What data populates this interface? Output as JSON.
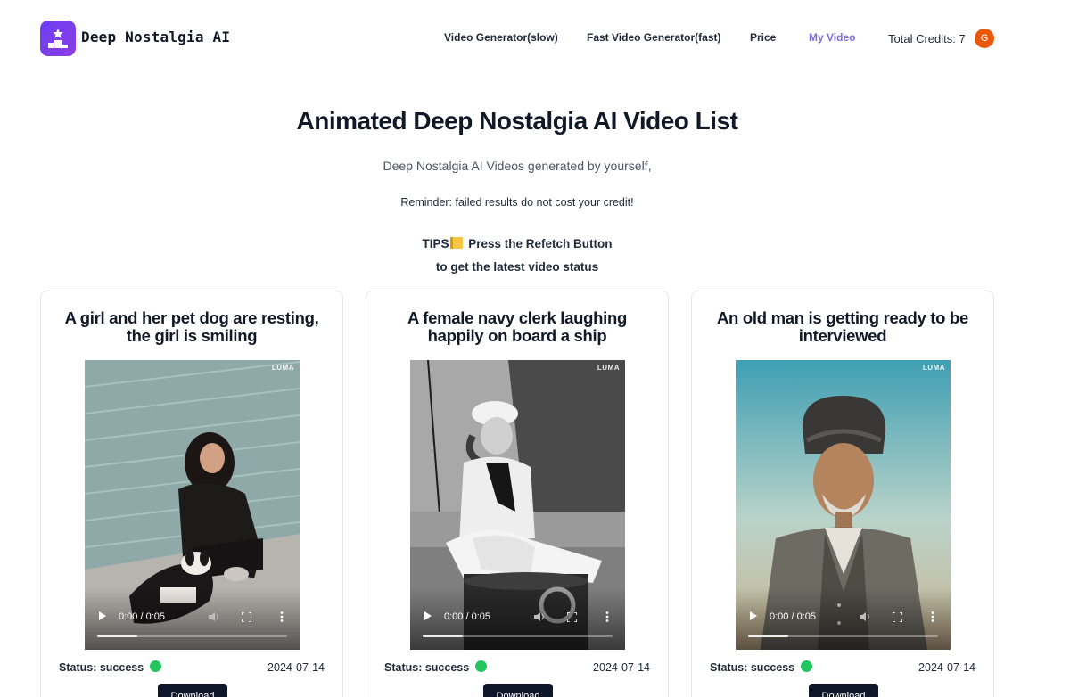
{
  "header": {
    "brand": "Deep Nostalgia AI",
    "nav": [
      {
        "label": "Video Generator(slow)",
        "active": false
      },
      {
        "label": "Fast Video Generator(fast)",
        "active": false
      },
      {
        "label": "Price",
        "active": false
      },
      {
        "label": "My Video",
        "active": true
      }
    ],
    "credits_label": "Total Credits: 7",
    "avatar_initial": "G"
  },
  "intro": {
    "title": "Animated Deep Nostalgia AI Video List",
    "subtitle": "Deep Nostalgia AI Videos generated by yourself,",
    "reminder": "Reminder: failed results do not cost your credit!",
    "tips_prefix": "TIPS",
    "tips_line1": "Press the Refetch Button",
    "tips_line2": "to get the latest video status"
  },
  "videos": [
    {
      "title": "A girl and her pet dog are resting, the girl is smiling",
      "watermark": "LUMA",
      "time": "0:00 / 0:05",
      "status": "Status: success",
      "date": "2024-07-14",
      "download_label": "Download"
    },
    {
      "title": "A female navy clerk laughing happily on board a ship",
      "watermark": "LUMA",
      "time": "0:00 / 0:05",
      "status": "Status: success",
      "date": "2024-07-14",
      "download_label": "Download"
    },
    {
      "title": "An old man is getting ready to be interviewed",
      "watermark": "LUMA",
      "time": "0:00 / 0:05",
      "status": "Status: success",
      "date": "2024-07-14",
      "download_label": "Download"
    }
  ],
  "colors": {
    "accent": "#7c6fe0",
    "logo": "#6d3df5",
    "status_success": "#22c55e",
    "button": "#0f172a",
    "avatar": "#ea580c"
  },
  "icons": [
    "podium-star-icon",
    "play-icon",
    "volume-icon",
    "fullscreen-icon",
    "more-vertical-icon",
    "notepad-emoji-icon"
  ]
}
